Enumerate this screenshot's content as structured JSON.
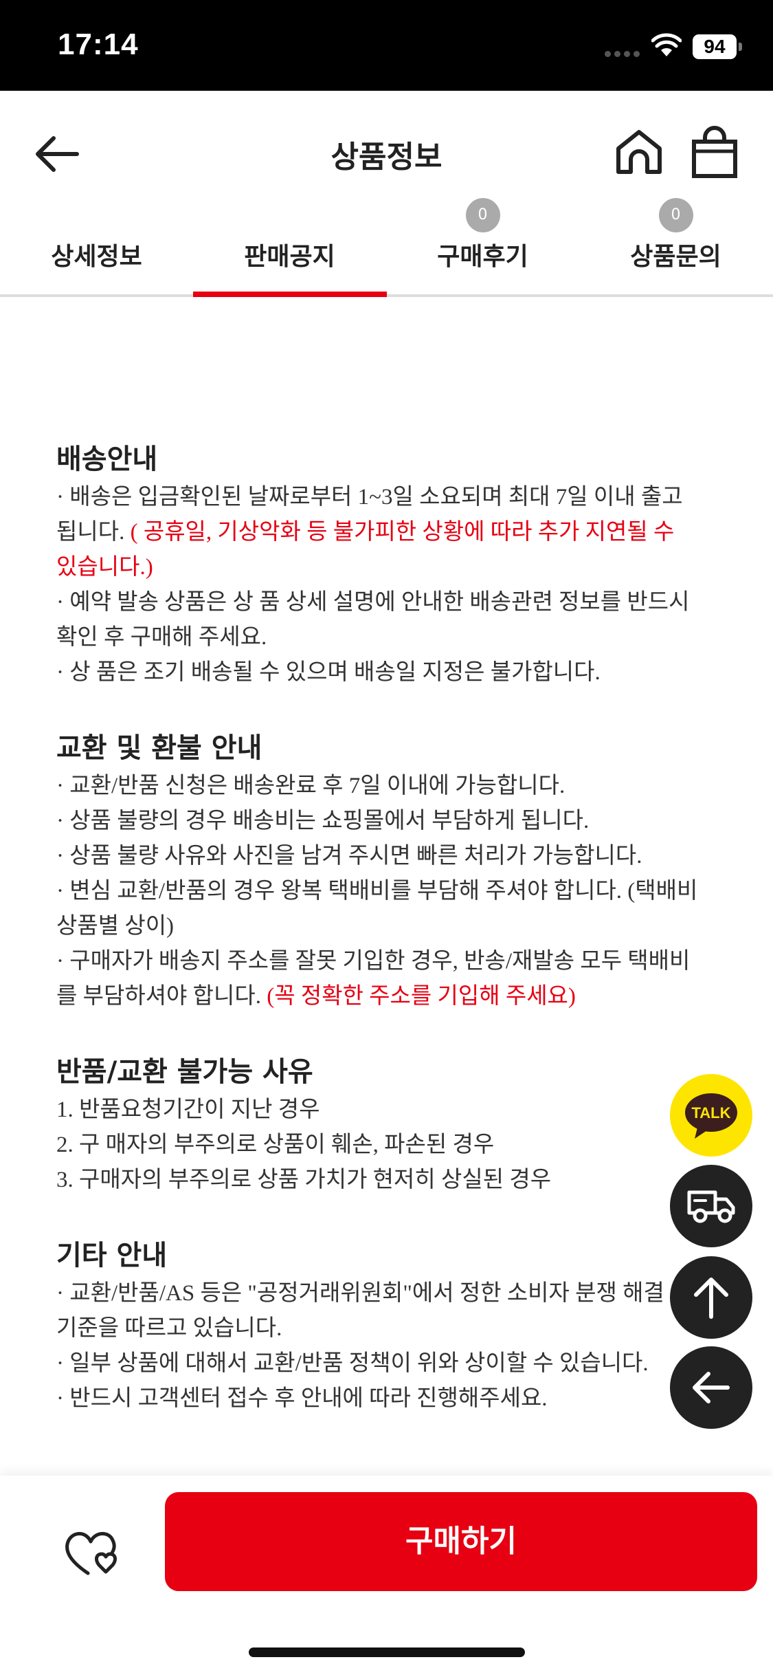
{
  "status_bar": {
    "time": "17:14",
    "battery": "94"
  },
  "header": {
    "title": "상품정보"
  },
  "tabs": [
    {
      "label": "상세정보",
      "badge": ""
    },
    {
      "label": "판매공지",
      "badge": ""
    },
    {
      "label": "구매후기",
      "badge": "0"
    },
    {
      "label": "상품문의",
      "badge": "0"
    }
  ],
  "active_tab": "판매공지",
  "sections": {
    "shipping": {
      "title": "배송안내",
      "line1": "· 배송은 입금확인된 날짜로부터 1~3일 소요되며 최대 7일 이내 출고",
      "line2a": "됩니다. ",
      "line2b": "( 공휴일, 기상악화 등 불가피한 상황에 따라 추가 지연될 수",
      "line3": "있습니다.)",
      "line4": "· 예약 발송 상품은 상 품 상세 설명에 안내한 배송관련 정보를 반드시",
      "line5": "확인 후 구매해 주세요.",
      "line6": "· 상 품은 조기 배송될 수 있으며 배송일 지정은 불가합니다."
    },
    "exchange": {
      "title": "교환 및 환불 안내",
      "line1": "· 교환/반품 신청은 배송완료 후 7일 이내에 가능합니다.",
      "line2": "· 상품 불량의 경우 배송비는 쇼핑몰에서 부담하게 됩니다.",
      "line3": "· 상품 불량 사유와 사진을 남겨 주시면 빠른 처리가 가능합니다.",
      "line4": "· 변심 교환/반품의 경우 왕복 택배비를 부담해 주셔야 합니다. (택배비",
      "line5": "상품별 상이)",
      "line6": "· 구매자가 배송지 주소를 잘못 기입한 경우, 반송/재발송 모두 택배비",
      "line7a": "를 부담하셔야 합니다. ",
      "line7b": "(꼭 정확한 주소를 기입해 주세요)"
    },
    "no_return": {
      "title": "반품/교환 불가능 사유",
      "line1": "1. 반품요청기간이 지난 경우",
      "line2": "2. 구 매자의 부주의로 상품이 훼손, 파손된 경우",
      "line3": "3. 구매자의 부주의로 상품 가치가 현저히 상실된 경우"
    },
    "etc": {
      "title": "기타 안내",
      "line1": "·  교환/반품/AS 등은 \"공정거래위원회\"에서 정한 소비자 분쟁 해결",
      "line2": "기준을 따르고 있습니다.",
      "line3": "·  일부 상품에 대해서 교환/반품 정책이 위와 상이할 수 있습니다.",
      "line4": "·  반드시 고객센터 접수 후 안내에 따라 진행해주세요."
    }
  },
  "fabs": {
    "talk_label": "TALK"
  },
  "bottom_bar": {
    "buy_label": "구매하기"
  },
  "colors": {
    "accent": "#e60012",
    "kakao": "#fee500"
  },
  "icons": [
    "back-arrow-icon",
    "home-icon",
    "shopping-bag-icon",
    "heart-icon",
    "kakao-talk-icon",
    "delivery-truck-icon",
    "arrow-up-icon",
    "arrow-left-icon"
  ]
}
